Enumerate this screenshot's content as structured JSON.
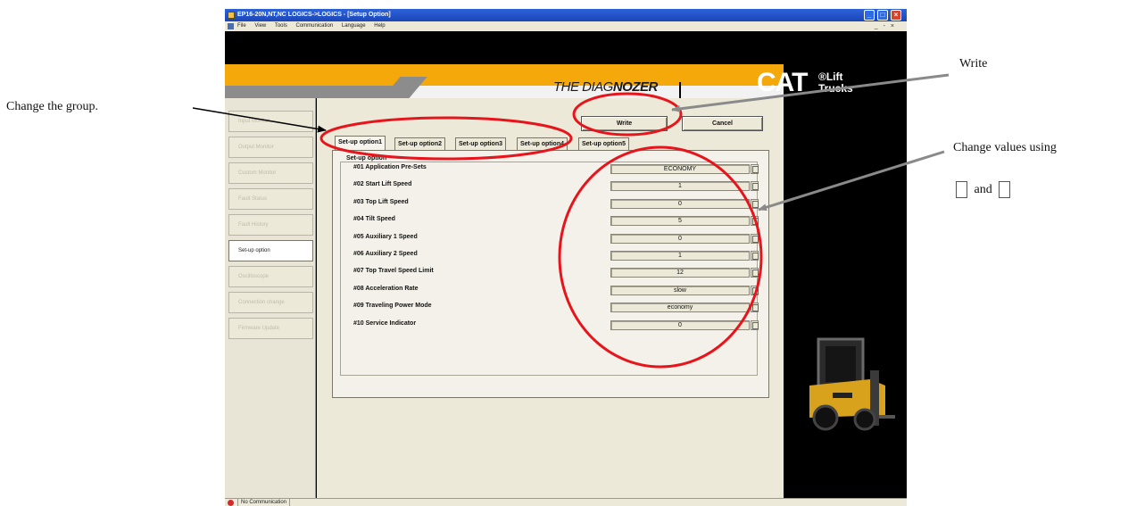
{
  "window": {
    "title": "EP16-20N,NT,NC LOGICS->LOGICS - [Setup Option]",
    "menus": [
      "File",
      "View",
      "Tools",
      "Communication",
      "Language",
      "Help"
    ],
    "mdi_controls": "_ ‑ ×"
  },
  "branding": {
    "diagnozer_prefix": "THE DIAG",
    "diagnozer_suffix": "NOZER",
    "cat": "CAT",
    "cat_sub_line1": "®Lift",
    "cat_sub_line2": "Trucks"
  },
  "sidebar": {
    "items": [
      {
        "label": "Input Monitor",
        "active": false
      },
      {
        "label": "Output Monitor",
        "active": false
      },
      {
        "label": "Custom Monitor",
        "active": false
      },
      {
        "label": "Fault Status",
        "active": false
      },
      {
        "label": "Fault History",
        "active": false
      },
      {
        "label": "Set-up option",
        "active": true
      },
      {
        "label": "Oscilloscope",
        "active": false
      },
      {
        "label": "Connection change",
        "active": false
      },
      {
        "label": "Firmware Update",
        "active": false
      }
    ]
  },
  "toolbar": {
    "write_label": "Write",
    "cancel_label": "Cancel"
  },
  "tabs": [
    {
      "label": "Set-up option1",
      "active": true
    },
    {
      "label": "Set-up option2",
      "active": false
    },
    {
      "label": "Set-up option3",
      "active": false
    },
    {
      "label": "Set-up option4",
      "active": false
    },
    {
      "label": "Set-up option5",
      "active": false
    }
  ],
  "setup": {
    "group_title": "Set-up option",
    "rows": [
      {
        "label": "#01 Application Pre-Sets",
        "value": "ECONOMY"
      },
      {
        "label": "#02 Start Lift Speed",
        "value": "1"
      },
      {
        "label": "#03 Top Lift Speed",
        "value": "0"
      },
      {
        "label": "#04 Tilt Speed",
        "value": "5"
      },
      {
        "label": "#05 Auxiliary 1 Speed",
        "value": "0"
      },
      {
        "label": "#06 Auxiliary 2 Speed",
        "value": "1"
      },
      {
        "label": "#07 Top Travel Speed Limit",
        "value": "12"
      },
      {
        "label": "#08 Acceleration Rate",
        "value": "slow"
      },
      {
        "label": "#09 Traveling Power Mode",
        "value": "economy"
      },
      {
        "label": "#10 Service Indicator",
        "value": "0"
      }
    ]
  },
  "status": {
    "text": "No Communication"
  },
  "annotations": {
    "change_group": "Change the group.",
    "write": "Write",
    "change_values_line1": "Change values using",
    "change_values_and": "and"
  },
  "colors": {
    "annotation_ellipse": "#e8141c",
    "pointer_black": "#000000",
    "pointer_gray": "#8a8a8a",
    "banner_orange": "#f4a80a"
  }
}
